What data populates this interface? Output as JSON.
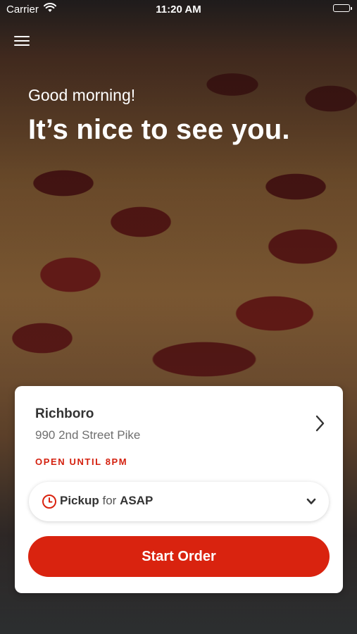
{
  "status_bar": {
    "carrier": "Carrier",
    "time": "11:20 AM",
    "icons": [
      "wifi-icon",
      "battery-icon"
    ]
  },
  "header": {
    "menu_icon": "hamburger-menu-icon",
    "greeting": "Good morning!",
    "headline": "It’s nice to see you."
  },
  "location_card": {
    "name": "Richboro",
    "address": "990 2nd Street Pike",
    "hours": "OPEN UNTIL 8PM",
    "chevron_icon": "chevron-right-icon",
    "order_mode": {
      "icon": "clock-icon",
      "method": "Pickup",
      "connector": "for",
      "time": "ASAP",
      "chevron_icon": "chevron-down-icon"
    },
    "start_button_label": "Start Order"
  },
  "colors": {
    "accent": "#d9230f",
    "hours_text": "#d4210f",
    "card_bg": "#ffffff",
    "text_dark": "#333333",
    "text_muted": "#6f6f6f"
  }
}
